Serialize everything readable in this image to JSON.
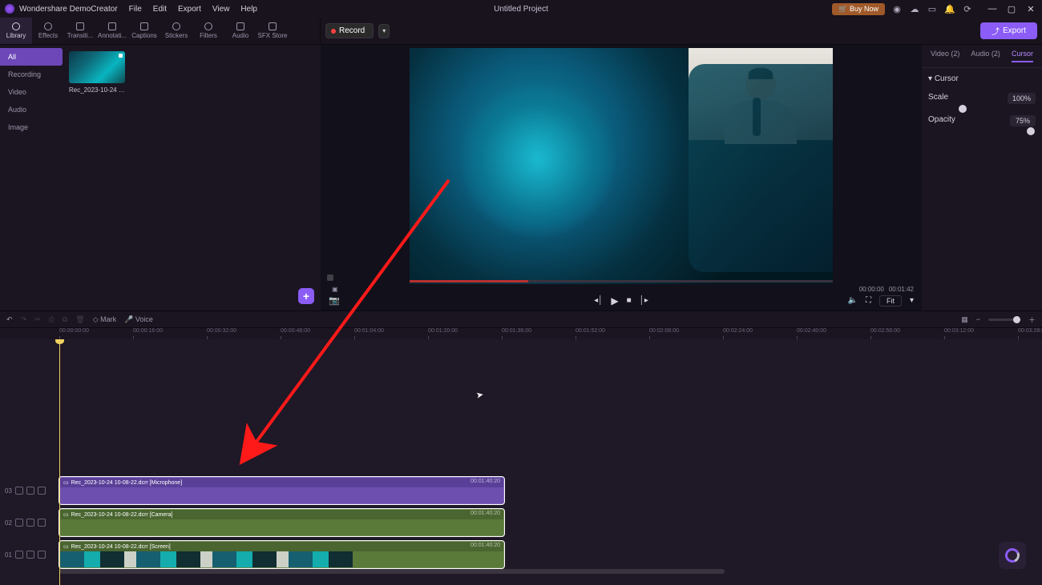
{
  "app": {
    "name": "Wondershare DemoCreator",
    "project_title": "Untitled Project"
  },
  "menubar": [
    "File",
    "Edit",
    "Export",
    "View",
    "Help"
  ],
  "titlebar_buttons": {
    "buy": "🛒 Buy Now"
  },
  "ribbon_tabs": [
    {
      "label": "Library",
      "active": true
    },
    {
      "label": "Effects"
    },
    {
      "label": "Transiti..."
    },
    {
      "label": "Annotati..."
    },
    {
      "label": "Captions"
    },
    {
      "label": "Stickers"
    },
    {
      "label": "Filters"
    },
    {
      "label": "Audio"
    },
    {
      "label": "SFX Store"
    }
  ],
  "record_button": "Record",
  "export_button": "Export",
  "categories": [
    {
      "label": "All",
      "active": true
    },
    {
      "label": "Recording"
    },
    {
      "label": "Video"
    },
    {
      "label": "Audio"
    },
    {
      "label": "Image"
    }
  ],
  "media_items": [
    {
      "label": "Rec_2023-10-24 10..."
    }
  ],
  "preview_time": {
    "current": "00:00:00",
    "total": "00:01:42"
  },
  "fit_label": "Fit",
  "properties": {
    "tabs": [
      {
        "label": "Video (2)"
      },
      {
        "label": "Audio (2)"
      },
      {
        "label": "Cursor",
        "active": true
      }
    ],
    "section": "Cursor",
    "scale": {
      "label": "Scale",
      "value": "100%",
      "percent": 30
    },
    "opacity": {
      "label": "Opacity",
      "value": "75%",
      "percent": 100
    }
  },
  "timeline_toolbar": {
    "mark": "Mark",
    "voice": "Voice"
  },
  "ruler_ticks": [
    "00:00:00:00",
    "00:00:16:00",
    "00:00:32:00",
    "00:00:48:00",
    "00:01:04:00",
    "00:01:20:00",
    "00:01:36:00",
    "00:01:52:00",
    "00:02:08:00",
    "00:02:24:00",
    "00:02:40:00",
    "00:02:56:00",
    "00:03:12:00",
    "00:03:28:00"
  ],
  "tracks": {
    "t3": {
      "id": "03",
      "clip_label": "Rec_2023-10-24 10-08-22.dcrr [Microphone]",
      "duration": "00:01:40:20"
    },
    "t2": {
      "id": "02",
      "clip_label": "Rec_2023-10-24 10-08-22.dcrr [Camera]",
      "duration": "00:01:40:20"
    },
    "t1": {
      "id": "01",
      "clip_label": "Rec_2023-10-24 10-08-22.dcrr [Screen]",
      "duration": "00:01:40:20"
    }
  }
}
